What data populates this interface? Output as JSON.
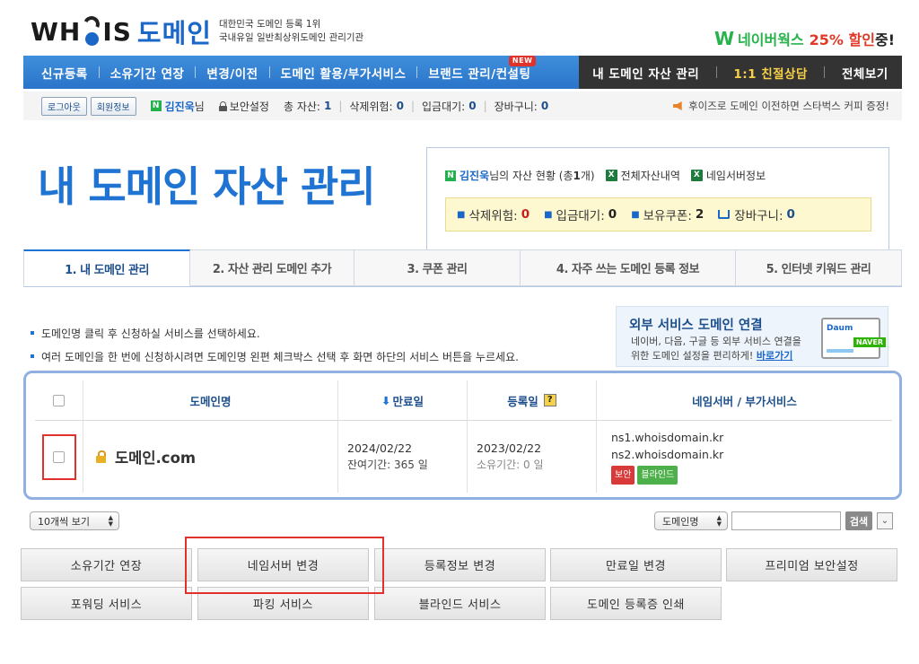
{
  "header": {
    "logo_word_left": "WH",
    "logo_word_right": "IS",
    "logo_kr": "도메인",
    "logo_sub_1": "대한민국 도메인 등록 1위",
    "logo_sub_2": "국내유일 일반최상위도메인 관리기관",
    "promo_w": "W",
    "promo_naver": "네이버웍스",
    "promo_pct": "25% 할인",
    "promo_end": "중!"
  },
  "nav": {
    "items": [
      "신규등록",
      "소유기간 연장",
      "변경/이전",
      "도메인 활용/부가서비스",
      "브랜드 관리/컨설팅"
    ],
    "new_badge": "NEW",
    "dark_items": [
      "내 도메인 자산 관리",
      "1:1 친절상담",
      "전체보기"
    ]
  },
  "userbar": {
    "logout": "로그아웃",
    "member_info": "회원정보",
    "naver_badge": "N",
    "user_name": "김진욱",
    "user_suffix": "님",
    "security": "보안설정",
    "total_assets_label": "총 자산:",
    "total_assets": "1",
    "delete_risk_label": "삭제위험:",
    "delete_risk": "0",
    "pending_label": "입금대기:",
    "pending": "0",
    "cart_label": "장바구니:",
    "cart": "0",
    "notice": "후이즈로 도메인 이전하면 스타벅스 커피 증정!"
  },
  "title": {
    "main": "내 도메인 자산 관리"
  },
  "asset_box": {
    "naver_badge": "N",
    "user_name": "김진욱",
    "status_prefix": "님의 자산 현황 (총 ",
    "count": "1",
    "status_suffix": " 개)",
    "xl_icon": "X",
    "all_assets_link": "전체자산내역",
    "nameserver_link": "네임서버정보",
    "delete_risk_label": "삭제위험:",
    "delete_risk": "0",
    "pending_label": "입금대기:",
    "pending": "0",
    "coupon_label": "보유쿠폰:",
    "coupon": "2",
    "cart_label": "장바구니:",
    "cart": "0"
  },
  "tabs": [
    "1. 내 도메인 관리",
    "2. 자산 관리 도메인 추가",
    "3. 쿠폰 관리",
    "4. 자주 쓰는 도메인 등록 정보",
    "5. 인터넷 키워드 관리"
  ],
  "notes": [
    "도메인명 클릭 후 신청하실 서비스를 선택하세요.",
    "여러 도메인을 한 번에 신청하시려면 도메인명 왼편 체크박스 선택 후 화면 하단의 서비스 버튼을 누르세요."
  ],
  "banner": {
    "title": "외부 서비스 도메인 연결",
    "line1": "네이버, 다음, 구글 등 외부 서비스 연결을",
    "line2": "위한 도메인 설정을 편리하게!",
    "link": "바로가기",
    "monitor_logo": "Daum",
    "monitor_naver": "NAVER"
  },
  "table": {
    "headers": {
      "domain": "도메인명",
      "expiry_arrow": "⬇",
      "expiry": "만료일",
      "registered": "등록일",
      "help": "?",
      "nameserver": "네임서버 / 부가서비스"
    },
    "rows": [
      {
        "domain": "도메인.com",
        "expiry_date": "2024/02/22",
        "remaining": "잔여기간: 365 일",
        "registered_date": "2023/02/22",
        "owned": "소유기간: 0 일",
        "ns1": "ns1.whoisdomain.kr",
        "ns2": "ns2.whoisdomain.kr",
        "tag_security": "보안",
        "tag_blind": "블라인드"
      }
    ]
  },
  "controls": {
    "per_page": "10개씩 보기",
    "search_field": "도메인명",
    "search_button": "검색",
    "expand": "⌄"
  },
  "actions": [
    "소유기간 연장",
    "네임서버 변경",
    "등록정보 변경",
    "만료일 변경",
    "프리미엄 보안설정",
    "포워딩 서비스",
    "파킹 서비스",
    "블라인드 서비스",
    "도메인 등록증 인쇄"
  ],
  "colors": {
    "brand_blue": "#1e73d3",
    "nav_dark": "#333333",
    "highlight_red": "#e0322b",
    "naver_green": "#28b24b"
  }
}
